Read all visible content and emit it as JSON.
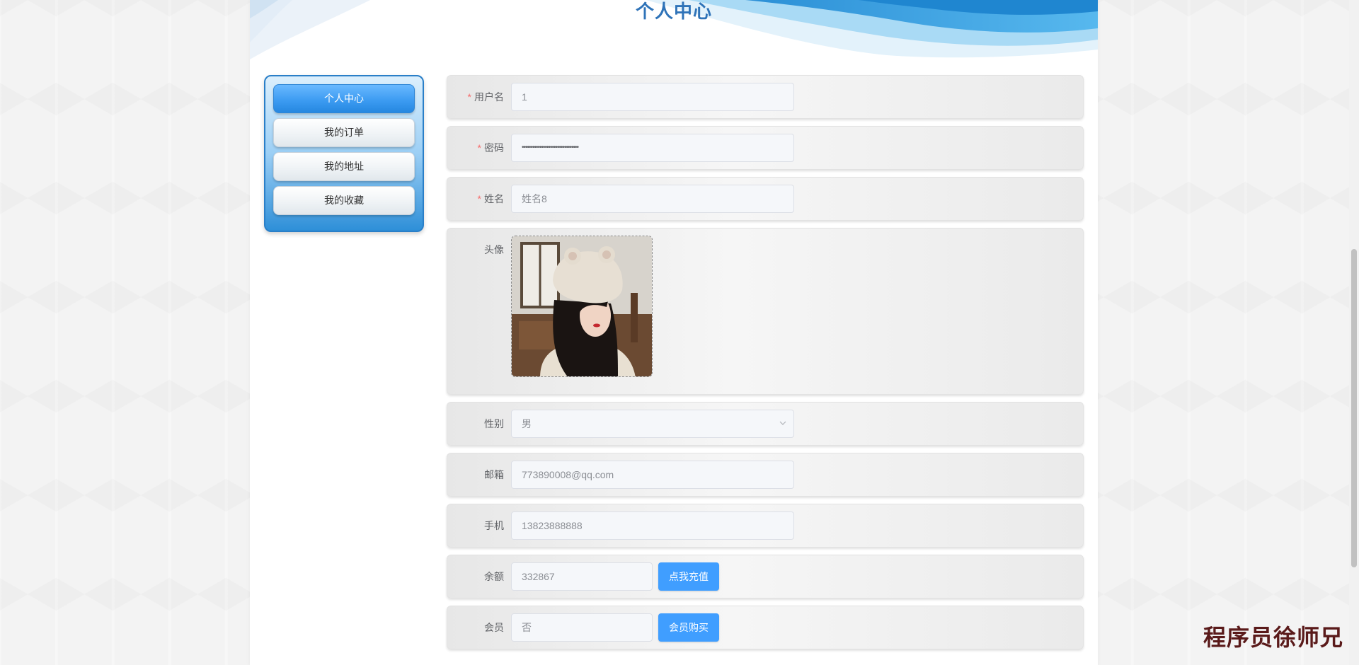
{
  "page_title": "个人中心",
  "sidebar": {
    "items": [
      {
        "label": "个人中心",
        "active": true
      },
      {
        "label": "我的订单",
        "active": false
      },
      {
        "label": "我的地址",
        "active": false
      },
      {
        "label": "我的收藏",
        "active": false
      }
    ]
  },
  "form": {
    "username": {
      "label": "用户名",
      "value": "1",
      "required": true
    },
    "password": {
      "label": "密码",
      "value": "••••••••••••••••••••••••••••••••",
      "required": true
    },
    "name": {
      "label": "姓名",
      "value": "姓名8",
      "required": true
    },
    "avatar": {
      "label": "头像"
    },
    "gender": {
      "label": "性别",
      "value": "男"
    },
    "email": {
      "label": "邮箱",
      "value": "773890008@qq.com"
    },
    "phone": {
      "label": "手机",
      "value": "13823888888"
    },
    "balance": {
      "label": "余额",
      "value": "332867",
      "button": "点我充值"
    },
    "vip": {
      "label": "会员",
      "value": "否",
      "button": "会员购买"
    }
  },
  "required_mark": "*",
  "watermark": "程序员徐师兄",
  "colors": {
    "title": "#2f73b8",
    "primary_button": "#409eff",
    "required": "#f56c6c"
  }
}
